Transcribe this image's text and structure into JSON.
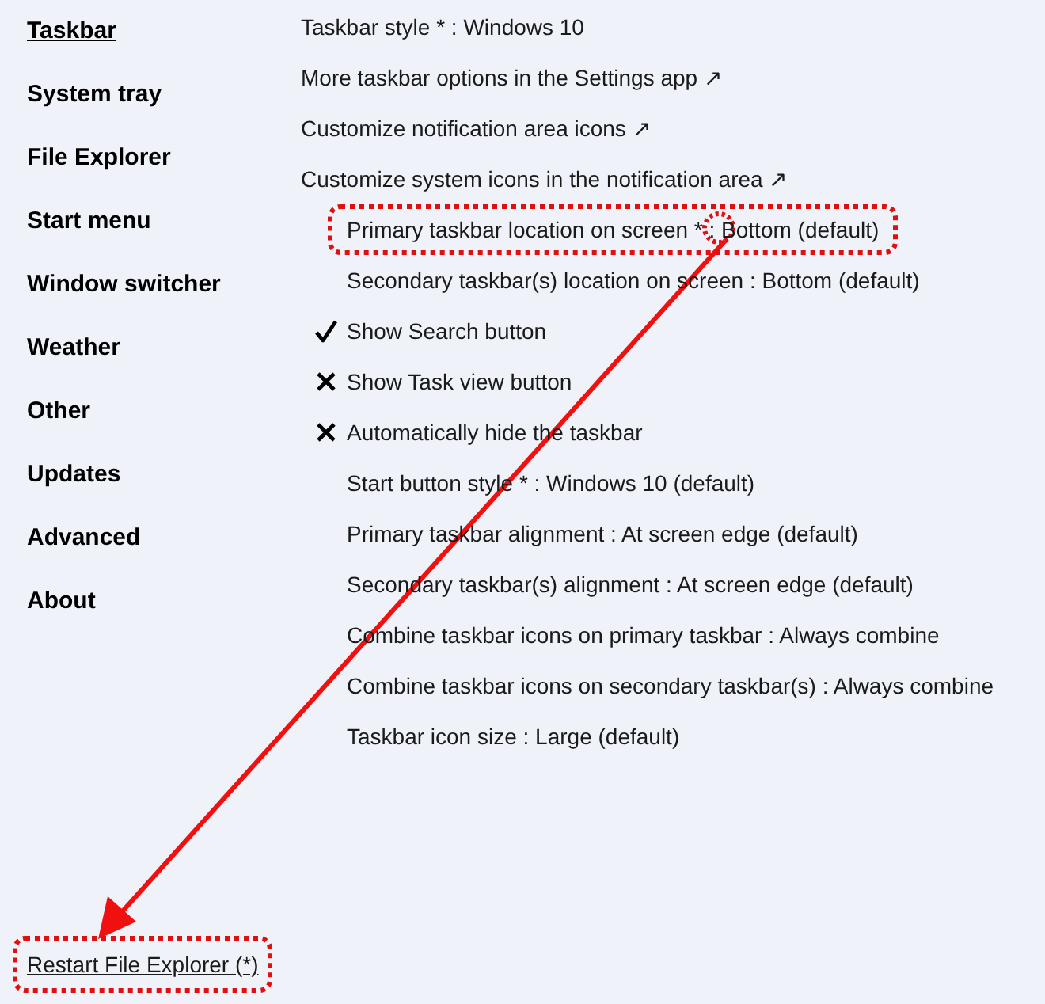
{
  "sidebar": {
    "items": [
      {
        "label": "Taskbar",
        "selected": true
      },
      {
        "label": "System tray",
        "selected": false
      },
      {
        "label": "File Explorer",
        "selected": false
      },
      {
        "label": "Start menu",
        "selected": false
      },
      {
        "label": "Window switcher",
        "selected": false
      },
      {
        "label": "Weather",
        "selected": false
      },
      {
        "label": "Other",
        "selected": false
      },
      {
        "label": "Updates",
        "selected": false
      },
      {
        "label": "Advanced",
        "selected": false
      },
      {
        "label": "About",
        "selected": false
      }
    ]
  },
  "settings": [
    {
      "kind": "main_option",
      "label": "Taskbar style * : Windows 10",
      "highlighted": false
    },
    {
      "kind": "link",
      "label": "More taskbar options in the Settings app ↗",
      "highlighted": false
    },
    {
      "kind": "link",
      "label": "Customize notification area icons ↗",
      "highlighted": false
    },
    {
      "kind": "link",
      "label": "Customize system icons in the notification area ↗",
      "highlighted": false
    },
    {
      "kind": "option",
      "label": "Primary taskbar location on screen * : Bottom (default)",
      "highlighted": true
    },
    {
      "kind": "option",
      "label": "Secondary taskbar(s) location on screen : Bottom (default)",
      "highlighted": false
    },
    {
      "kind": "toggle",
      "label": "Show Search button",
      "checked": true,
      "highlighted": false
    },
    {
      "kind": "toggle",
      "label": "Show Task view button",
      "checked": false,
      "highlighted": false
    },
    {
      "kind": "toggle",
      "label": "Automatically hide the taskbar",
      "checked": false,
      "highlighted": false
    },
    {
      "kind": "option",
      "label": "Start button style * : Windows 10 (default)",
      "highlighted": false
    },
    {
      "kind": "option",
      "label": "Primary taskbar alignment : At screen edge (default)",
      "highlighted": false
    },
    {
      "kind": "option",
      "label": "Secondary taskbar(s) alignment : At screen edge (default)",
      "highlighted": false
    },
    {
      "kind": "option",
      "label": "Combine taskbar icons on primary taskbar : Always combine",
      "highlighted": false
    },
    {
      "kind": "option",
      "label": "Combine taskbar icons on secondary taskbar(s) : Always combine",
      "highlighted": false
    },
    {
      "kind": "option",
      "label": "Taskbar icon size : Large (default)",
      "highlighted": false
    }
  ],
  "restart_link": {
    "label": "Restart File Explorer (*)",
    "highlighted": true
  }
}
